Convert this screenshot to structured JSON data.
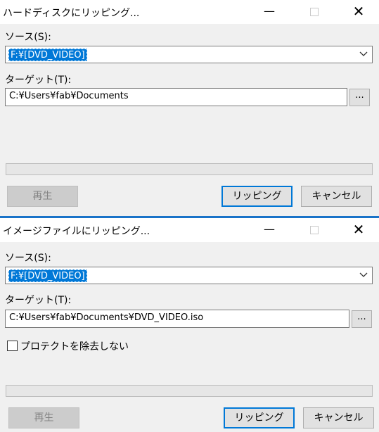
{
  "dialog_hdd": {
    "title": "ハードディスクにリッピング...",
    "window_controls": {
      "minimize": "—",
      "close": "✕"
    },
    "source_label": "ソース(S):",
    "source_value": "F:¥[DVD_VIDEO]",
    "target_label": "ターゲット(T):",
    "target_value": "C:¥Users¥fab¥Documents",
    "browse_label": "...",
    "progress": 0,
    "play_label": "再生",
    "rip_label": "リッピング",
    "cancel_label": "キャンセル"
  },
  "dialog_iso": {
    "title": "イメージファイルにリッピング...",
    "window_controls": {
      "minimize": "—",
      "close": "✕"
    },
    "source_label": "ソース(S):",
    "source_value": "F:¥[DVD_VIDEO]",
    "target_label": "ターゲット(T):",
    "target_value": "C:¥Users¥fab¥Documents¥DVD_VIDEO.iso",
    "browse_label": "...",
    "protect_label": "プロテクトを除去しない",
    "protect_checked": false,
    "progress": 0,
    "play_label": "再生",
    "rip_label": "リッピング",
    "cancel_label": "キャンセル"
  },
  "colors": {
    "accent": "#0078d7",
    "separator": "#1a73c8"
  }
}
